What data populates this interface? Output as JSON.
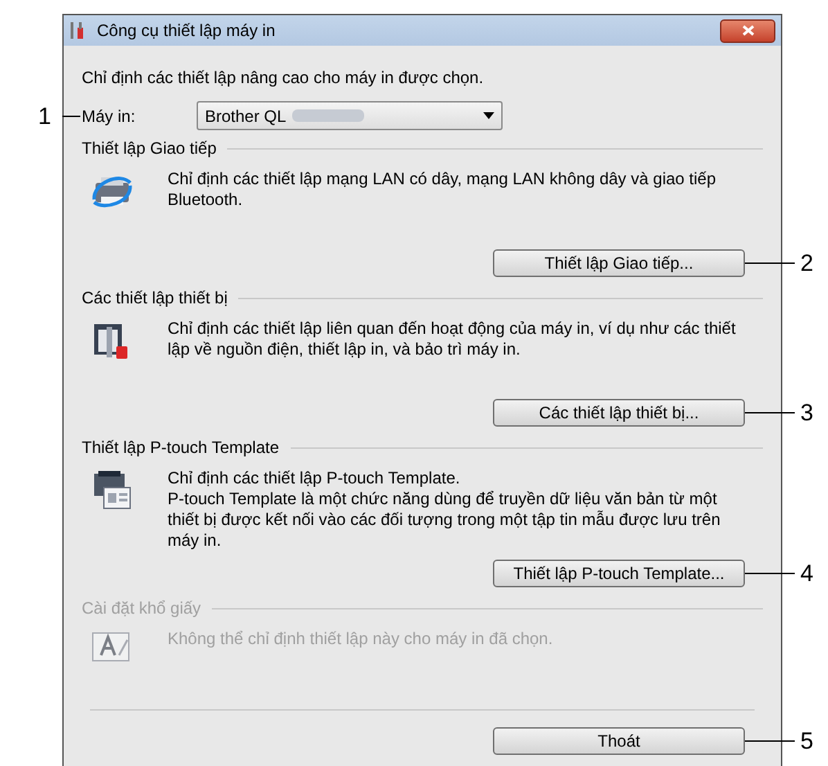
{
  "window": {
    "title": "Công cụ thiết lập máy in"
  },
  "intro": "Chỉ định các thiết lập nâng cao cho máy in được chọn.",
  "printer": {
    "label": "Máy in:",
    "value": "Brother QL",
    "callout": "1"
  },
  "sections": [
    {
      "kind": "network",
      "title": "Thiết lập Giao tiếp",
      "description": "Chỉ định các thiết lập mạng LAN có dây, mạng LAN không dây và giao tiếp Bluetooth.",
      "disabled": false,
      "button": {
        "label": "Thiết lập Giao tiếp...",
        "callout": "2"
      }
    },
    {
      "kind": "device",
      "title": "Các thiết lập thiết bị",
      "description": "Chỉ định các thiết lập liên quan đến hoạt động của máy in, ví dụ như các thiết lập về nguồn điện, thiết lập in, và bảo trì máy in.",
      "disabled": false,
      "button": {
        "label": "Các thiết lập thiết bị...",
        "callout": "3"
      }
    },
    {
      "kind": "template",
      "title": "Thiết lập P-touch Template",
      "description": "Chỉ định các thiết lập P-touch Template.\nP-touch Template là một chức năng dùng để truyền dữ liệu văn bản từ một thiết bị được kết nối vào các đối tượng trong một tập tin mẫu được lưu trên máy in.",
      "disabled": false,
      "button": {
        "label": "Thiết lập P-touch Template...",
        "callout": "4"
      }
    },
    {
      "kind": "paper",
      "title": "Cài đặt khổ giấy",
      "description": "Không thể chỉ định thiết lập này cho máy in đã chọn.",
      "disabled": true
    }
  ],
  "exit_button": {
    "label": "Thoát",
    "callout": "5"
  }
}
